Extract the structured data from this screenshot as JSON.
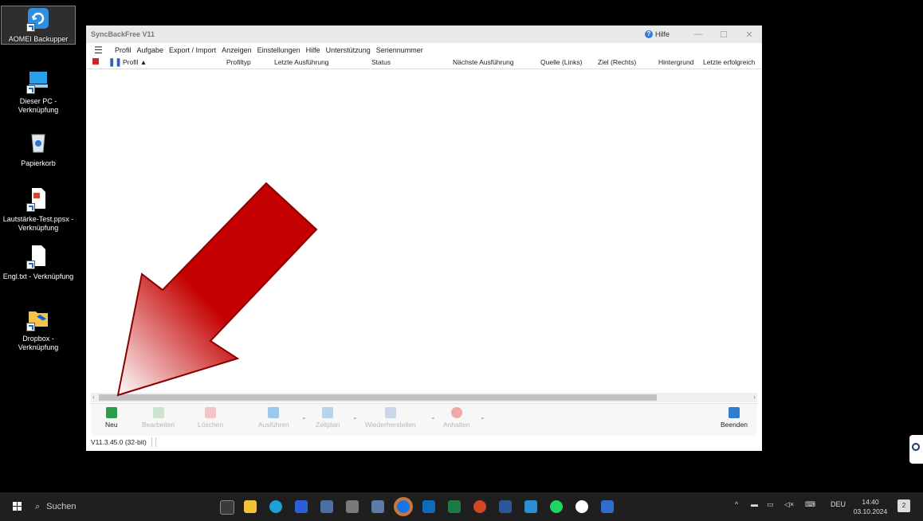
{
  "desktop": {
    "icons": [
      {
        "label": "AOMEI Backupper"
      },
      {
        "label": "Dieser PC - Verknüpfung"
      },
      {
        "label": "Papierkorb"
      },
      {
        "label": "Lautstärke-Test.ppsx - Verknüpfung"
      },
      {
        "label": "Engl.txt - Verknüpfung"
      },
      {
        "label": "Dropbox - Verknüpfung"
      }
    ]
  },
  "window": {
    "title": "SyncBackFree V11",
    "help_label": "Hilfe",
    "controls": {
      "minimize": "—",
      "maximize": "☐",
      "close": "✕"
    },
    "menu": [
      "Profil",
      "Aufgabe",
      "Export / Import",
      "Anzeigen",
      "Einstellungen",
      "Hilfe",
      "Unterstützung",
      "Seriennummer"
    ],
    "columns": [
      "Profil ▲",
      "Profiltyp",
      "Letzte Ausführung",
      "Status",
      "Nächste Ausführung",
      "Quelle (Links)",
      "Ziel (Rechts)",
      "Hintergrund",
      "Letzte erfolgreich"
    ],
    "toolbar": {
      "new": "Neu",
      "edit": "Bearbeiten",
      "delete": "Löschen",
      "run": "Ausführen",
      "schedule": "Zeitplan",
      "restore": "Wiederherstellen",
      "stop": "Anhalten",
      "exit": "Beenden"
    },
    "status_version": "V11.3.45.0 (32-bit)"
  },
  "taskbar": {
    "search_placeholder": "Suchen",
    "tray_lang": "DEU",
    "time": "14:40",
    "date": "03.10.2024",
    "notifications": "2"
  },
  "colors": {
    "accent_blue": "#2d7fd3",
    "arrow_red": "#c40000",
    "new_green": "#2e9d4b"
  }
}
